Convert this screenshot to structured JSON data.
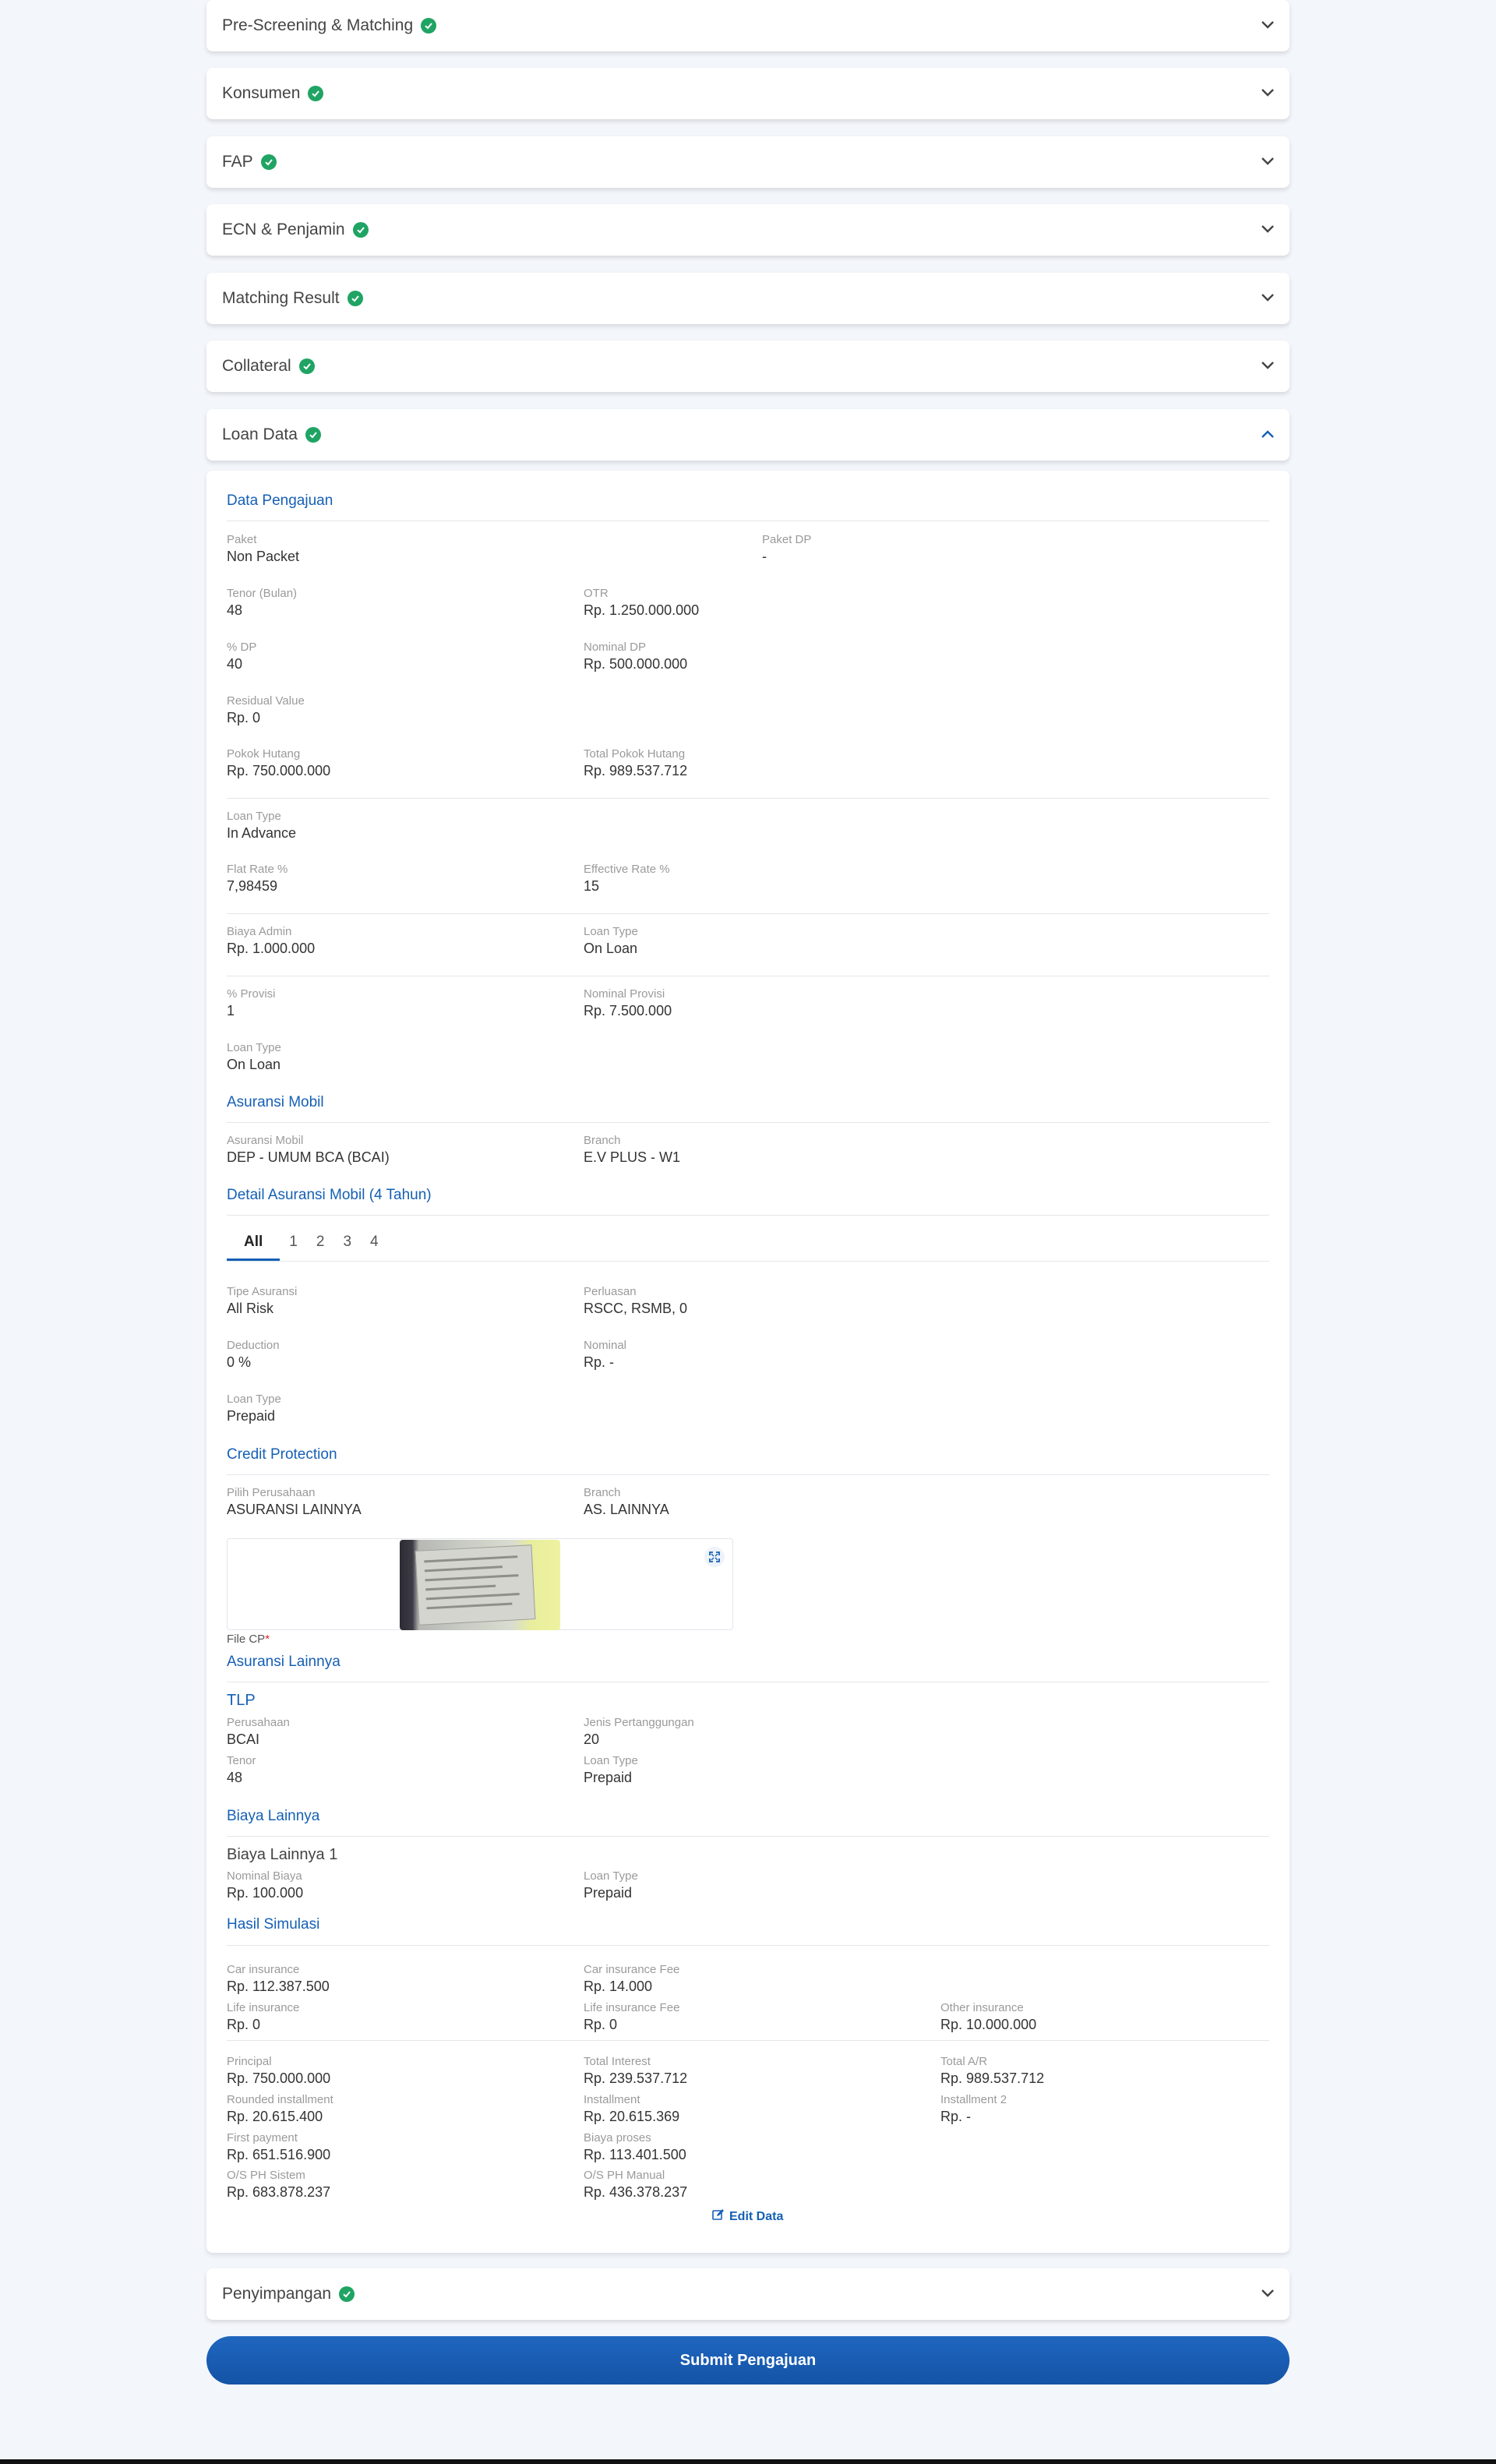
{
  "accordions": [
    {
      "title": "Pre-Screening & Matching"
    },
    {
      "title": "Konsumen"
    },
    {
      "title": "FAP"
    },
    {
      "title": "ECN & Penjamin"
    },
    {
      "title": "Matching Result"
    },
    {
      "title": "Collateral"
    },
    {
      "title": "Loan Data"
    }
  ],
  "penyimpangan": {
    "title": "Penyimpangan"
  },
  "loan": {
    "data_pengajuan": {
      "title": "Data Pengajuan",
      "paket_label": "Paket",
      "paket": "Non Packet",
      "paket_dp_label": "Paket DP",
      "paket_dp": "-",
      "tenor_label": "Tenor (Bulan)",
      "tenor": "48",
      "otr_label": "OTR",
      "otr": "Rp. 1.250.000.000",
      "dp_pct_label": "% DP",
      "dp_pct": "40",
      "nominal_dp_label": "Nominal DP",
      "nominal_dp": "Rp. 500.000.000",
      "residual_label": "Residual Value",
      "residual": "Rp. 0",
      "pokok_label": "Pokok Hutang",
      "pokok": "Rp. 750.000.000",
      "total_pokok_label": "Total Pokok Hutang",
      "total_pokok": "Rp. 989.537.712",
      "loan_type_label": "Loan Type",
      "loan_type": "In Advance",
      "flat_label": "Flat Rate %",
      "flat": "7,98459",
      "eff_label": "Effective Rate %",
      "eff": "15",
      "admin_label": "Biaya Admin",
      "admin": "Rp. 1.000.000",
      "admin_type_label": "Loan Type",
      "admin_type": "On Loan",
      "provisi_label": "% Provisi",
      "provisi": "1",
      "nom_provisi_label": "Nominal Provisi",
      "nom_provisi": "Rp. 7.500.000",
      "provisi_type_label": "Loan Type",
      "provisi_type": "On Loan"
    },
    "asuransi_mobil": {
      "title": "Asuransi Mobil",
      "asuransi_label": "Asuransi Mobil",
      "asuransi": "DEP - UMUM BCA (BCAI)",
      "branch_label": "Branch",
      "branch": "E.V PLUS - W1"
    },
    "detail_asuransi": {
      "title": "Detail Asuransi Mobil (4 Tahun)",
      "tabs": [
        "All",
        "1",
        "2",
        "3",
        "4"
      ],
      "tipe_label": "Tipe Asuransi",
      "tipe": "All Risk",
      "perluasan_label": "Perluasan",
      "perluasan": "RSCC, RSMB, 0",
      "deduction_label": "Deduction",
      "deduction": "0 %",
      "nominal_label": "Nominal",
      "nominal": "Rp. -",
      "type_label": "Loan Type",
      "type": "Prepaid"
    },
    "credit_protection": {
      "title": "Credit Protection",
      "perusahaan_label": "Pilih Perusahaan",
      "perusahaan": "ASURANSI LAINNYA",
      "branch_label": "Branch",
      "branch": "AS. LAINNYA",
      "file_label": "File CP",
      "required_mark": "*"
    },
    "asuransi_lainnya": {
      "title": "Asuransi Lainnya",
      "tlp": "TLP",
      "perusahaan_label": "Perusahaan",
      "perusahaan": "BCAI",
      "jenis_label": "Jenis Pertanggungan",
      "jenis": "20",
      "tenor_label": "Tenor",
      "tenor": "48",
      "type_label": "Loan Type",
      "type": "Prepaid"
    },
    "biaya_lainnya": {
      "title": "Biaya Lainnya",
      "item": "Biaya Lainnya 1",
      "nominal_label": "Nominal Biaya",
      "nominal": "Rp. 100.000",
      "type_label": "Loan Type",
      "type": "Prepaid"
    },
    "hasil_simulasi": {
      "title": "Hasil Simulasi",
      "car_ins_label": "Car insurance",
      "car_ins": "Rp. 112.387.500",
      "car_fee_label": "Car insurance Fee",
      "car_fee": "Rp. 14.000",
      "life_label": "Life insurance",
      "life": "Rp. 0",
      "life_fee_label": "Life insurance Fee",
      "life_fee": "Rp. 0",
      "other_label": "Other insurance",
      "other": "Rp. 10.000.000",
      "principal_label": "Principal",
      "principal": "Rp. 750.000.000",
      "interest_label": "Total Interest",
      "interest": "Rp. 239.537.712",
      "ar_label": "Total A/R",
      "ar": "Rp. 989.537.712",
      "rounded_label": "Rounded installment",
      "rounded": "Rp. 20.615.400",
      "installment_label": "Installment",
      "installment": "Rp. 20.615.369",
      "installment2_label": "Installment 2",
      "installment2": "Rp. -",
      "first_label": "First payment",
      "first": "Rp. 651.516.900",
      "biaya_label": "Biaya proses",
      "biaya": "Rp. 113.401.500",
      "os_sistem_label": "O/S PH Sistem",
      "os_sistem": "Rp. 683.878.237",
      "os_manual_label": "O/S PH Manual",
      "os_manual": "Rp. 436.378.237"
    },
    "edit_label": "Edit Data"
  },
  "submit_label": "Submit Pengajuan",
  "colors": {
    "accent": "#1560b5",
    "check": "#1fa463",
    "background": "#f3f6fb"
  },
  "icons": {
    "status": "check-circle-icon",
    "collapsed": "chevron-down-icon",
    "expanded": "chevron-up-icon",
    "expand": "expand-icon",
    "edit": "edit-icon"
  }
}
